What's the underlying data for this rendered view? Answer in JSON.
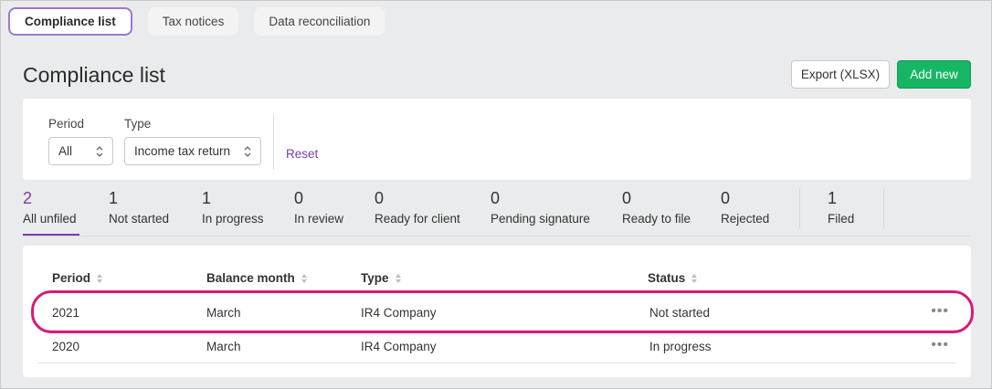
{
  "tabs": [
    {
      "label": "Compliance list",
      "active": true
    },
    {
      "label": "Tax notices",
      "active": false
    },
    {
      "label": "Data reconciliation",
      "active": false
    }
  ],
  "header": {
    "title": "Compliance list",
    "export_label": "Export (XLSX)",
    "add_label": "Add new"
  },
  "filters": {
    "period_label": "Period",
    "period_value": "All",
    "type_label": "Type",
    "type_value": "Income tax return",
    "reset_label": "Reset"
  },
  "statuses": [
    {
      "count": "2",
      "label": "All unfiled"
    },
    {
      "count": "1",
      "label": "Not started"
    },
    {
      "count": "1",
      "label": "In progress"
    },
    {
      "count": "0",
      "label": "In review"
    },
    {
      "count": "0",
      "label": "Ready for client"
    },
    {
      "count": "0",
      "label": "Pending signature"
    },
    {
      "count": "0",
      "label": "Ready to file"
    },
    {
      "count": "0",
      "label": "Rejected"
    },
    {
      "count": "1",
      "label": "Filed"
    }
  ],
  "table": {
    "columns": [
      "Period",
      "Balance month",
      "Type",
      "Status"
    ],
    "rows": [
      {
        "period": "2021",
        "month": "March",
        "type": "IR4 Company",
        "status": "Not started"
      },
      {
        "period": "2020",
        "month": "March",
        "type": "IR4 Company",
        "status": "In progress"
      }
    ],
    "more_glyph": "•••"
  },
  "colors": {
    "accent": "#7a3f9d",
    "add_button": "#16b664",
    "highlight": "#d81b76"
  }
}
